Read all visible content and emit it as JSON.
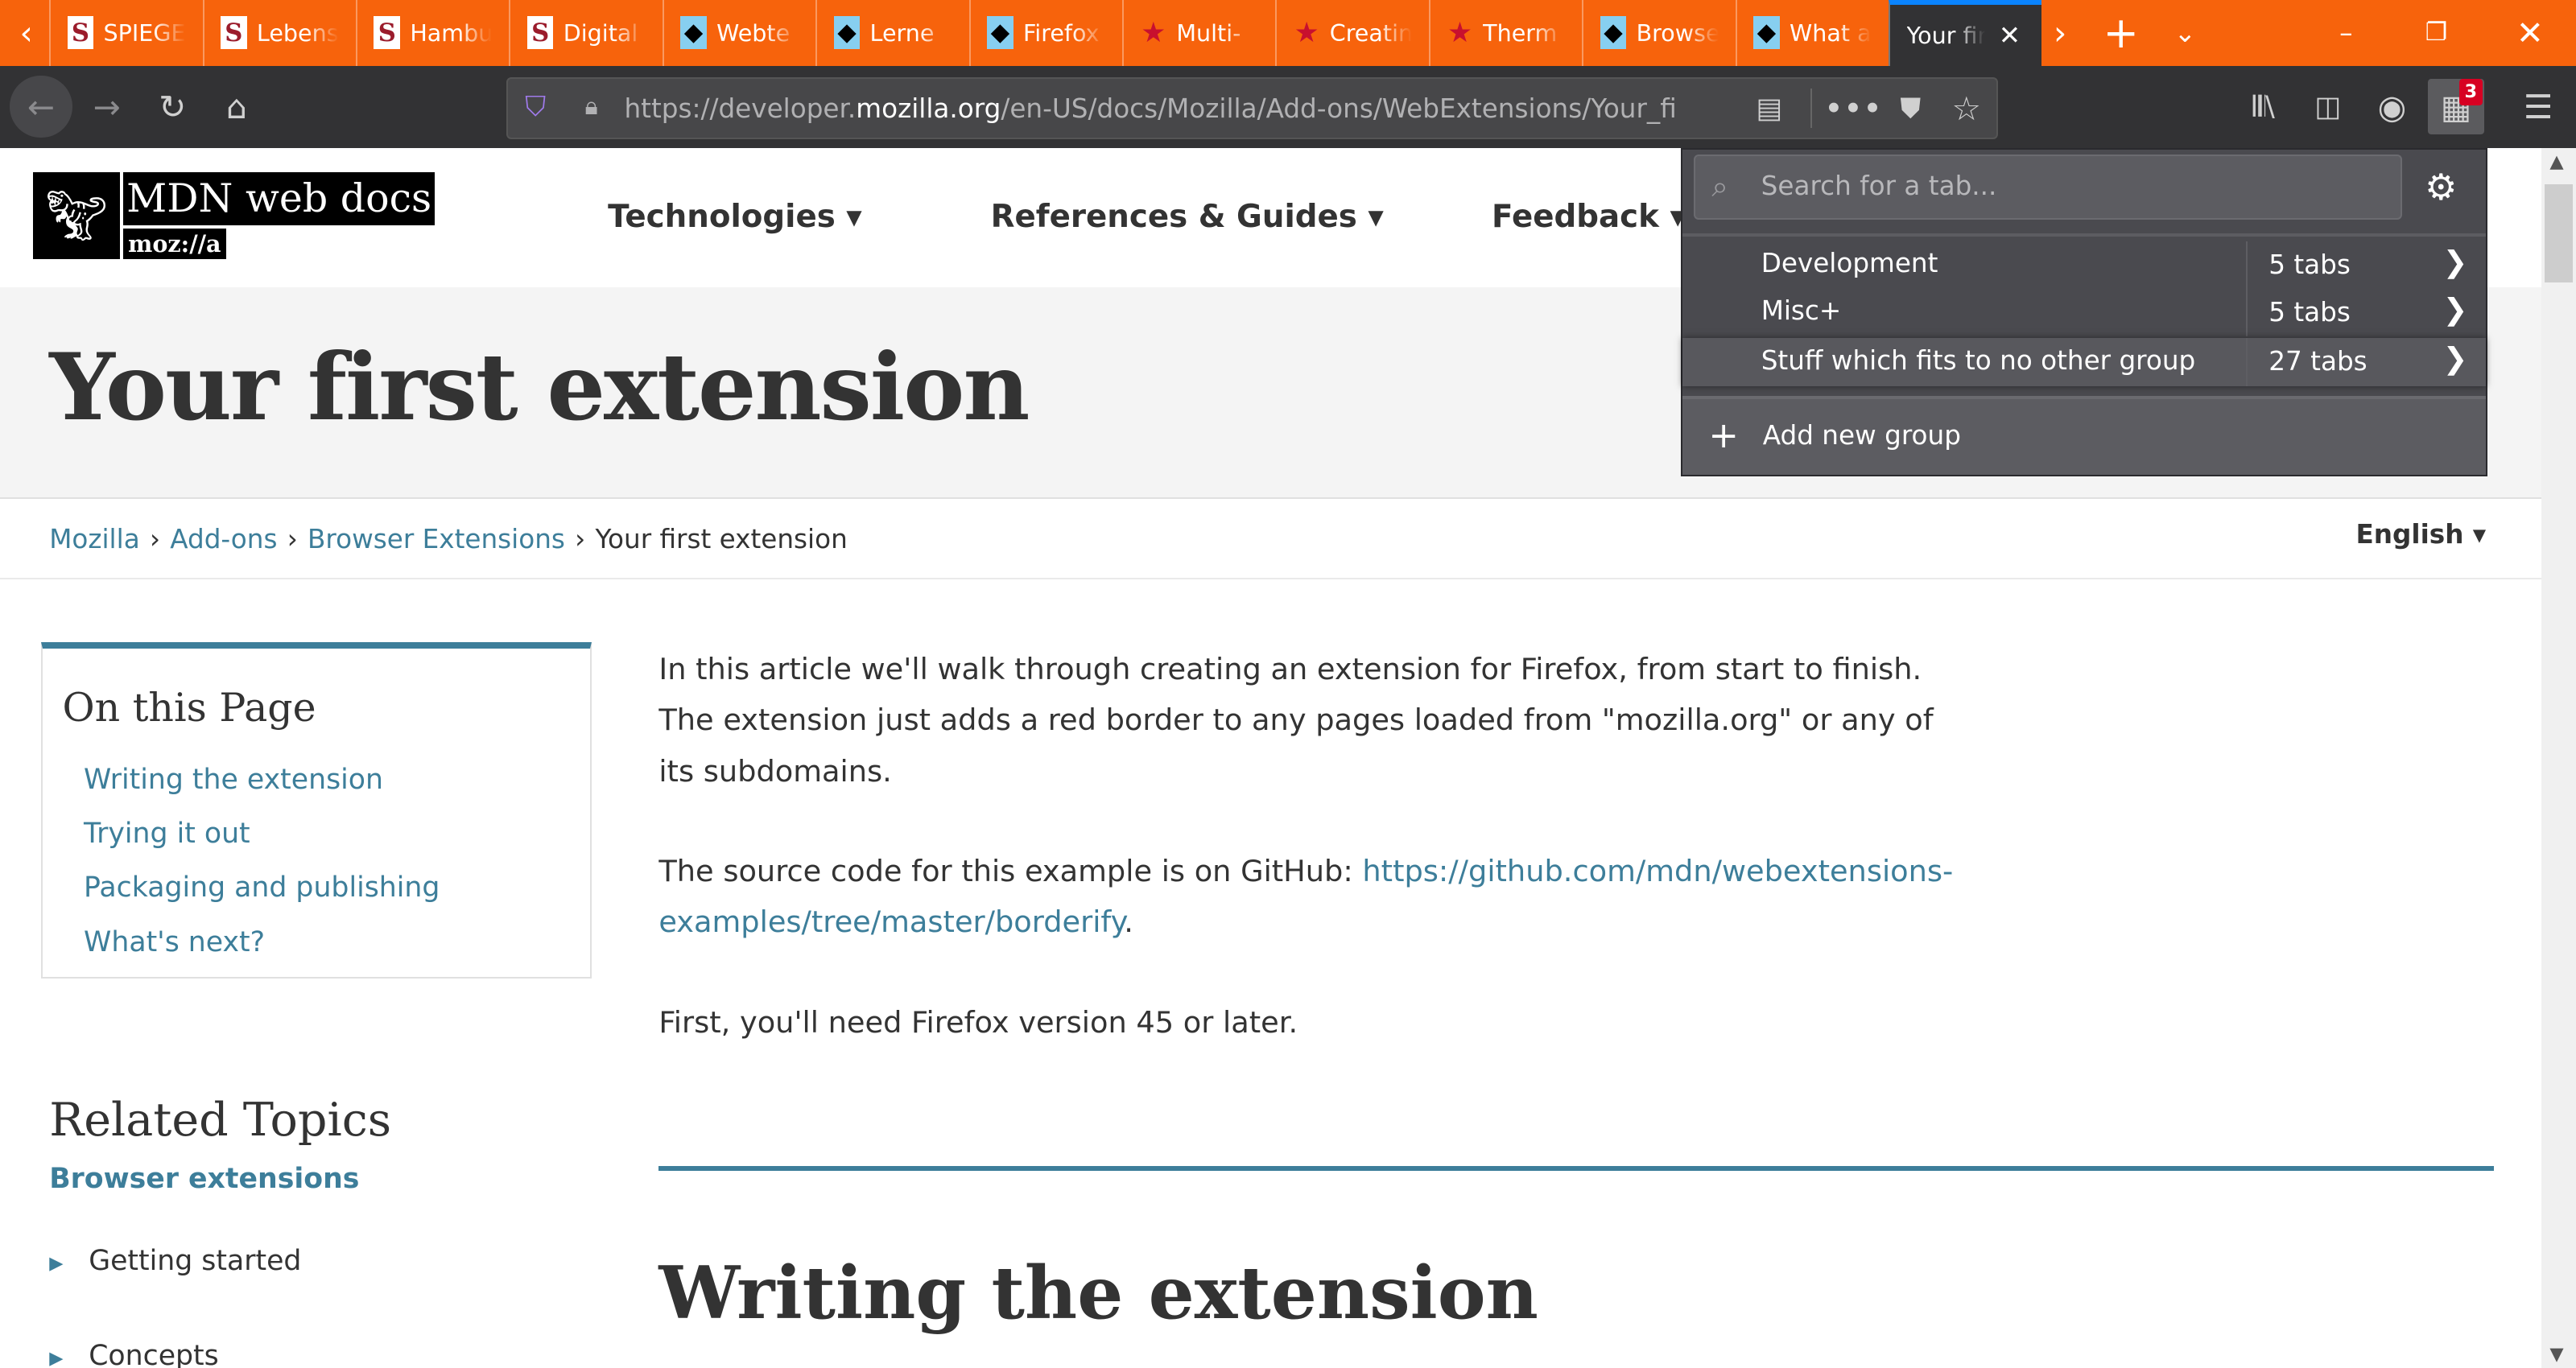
{
  "tabs": [
    {
      "title": "SPIEGEL",
      "icon": "spiegel-icon"
    },
    {
      "title": "Lebens",
      "icon": "spiegel-icon"
    },
    {
      "title": "Hambu",
      "icon": "spiegel-icon"
    },
    {
      "title": "Digital",
      "icon": "spiegel-icon"
    },
    {
      "title": "Webte",
      "icon": "mdn-icon"
    },
    {
      "title": "Lerne",
      "icon": "mdn-icon"
    },
    {
      "title": "Firefox",
      "icon": "mdn-icon"
    },
    {
      "title": "Multi-",
      "icon": "star-icon"
    },
    {
      "title": "Creatin",
      "icon": "star-icon"
    },
    {
      "title": "Therm",
      "icon": "star-icon"
    },
    {
      "title": "Browse",
      "icon": "mdn-icon"
    },
    {
      "title": "What a",
      "icon": "mdn-icon"
    },
    {
      "title": "Your fir",
      "icon": "none",
      "active": true
    }
  ],
  "favicon_glyphs": {
    "spiegel": "S",
    "star": "★",
    "mdn": "◆"
  },
  "url": {
    "pre": "https://developer.",
    "host": "mozilla.org",
    "path": "/en-US/docs/Mozilla/Add-ons/WebExtensions/Your_first_WebExtension"
  },
  "toolbar": {
    "badge": "3"
  },
  "mdn": {
    "logo_line1": "MDN web docs",
    "logo_line2": "moz://a",
    "nav": [
      "Technologies ▾",
      "References & Guides ▾",
      "Feedback ▾"
    ],
    "title": "Your first extension",
    "breadcrumb": [
      "Mozilla",
      "Add-ons",
      "Browser Extensions",
      "Your first extension"
    ],
    "language": "English ▾",
    "on_this_page": {
      "heading": "On this Page",
      "links": [
        "Writing the extension",
        "Trying it out",
        "Packaging and publishing",
        "What's next?"
      ]
    },
    "related": {
      "heading": "Related Topics",
      "sub": "Browser extensions",
      "items": [
        "Getting started",
        "Concepts"
      ]
    },
    "content": {
      "p1": "In this article we'll walk through creating an extension for Firefox, from start to finish. The extension just adds a red border to any pages loaded from \"mozilla.org\" or any of its subdomains.",
      "p2_pre": "The source code for this example is on GitHub: ",
      "p2_link": "https://github.com/mdn/webextensions-examples/tree/master/borderify",
      "p2_post": ".",
      "p3": "First, you'll need Firefox version 45 or later.",
      "h2": "Writing the extension"
    }
  },
  "popup": {
    "search_placeholder": "Search for a tab...",
    "groups": [
      {
        "name": "Development",
        "count": "5 tabs"
      },
      {
        "name": "Misc+",
        "count": "5 tabs"
      },
      {
        "name": "Stuff which fits to no other group",
        "count": "27 tabs",
        "highlighted": true
      }
    ],
    "add_group": "Add new group"
  },
  "colors": {
    "tabbar": "#f7630c",
    "toolbar": "#323234",
    "popup": "#4a4a4f",
    "link": "#3d7e9a",
    "active_tab_line": "#0a84ff"
  }
}
